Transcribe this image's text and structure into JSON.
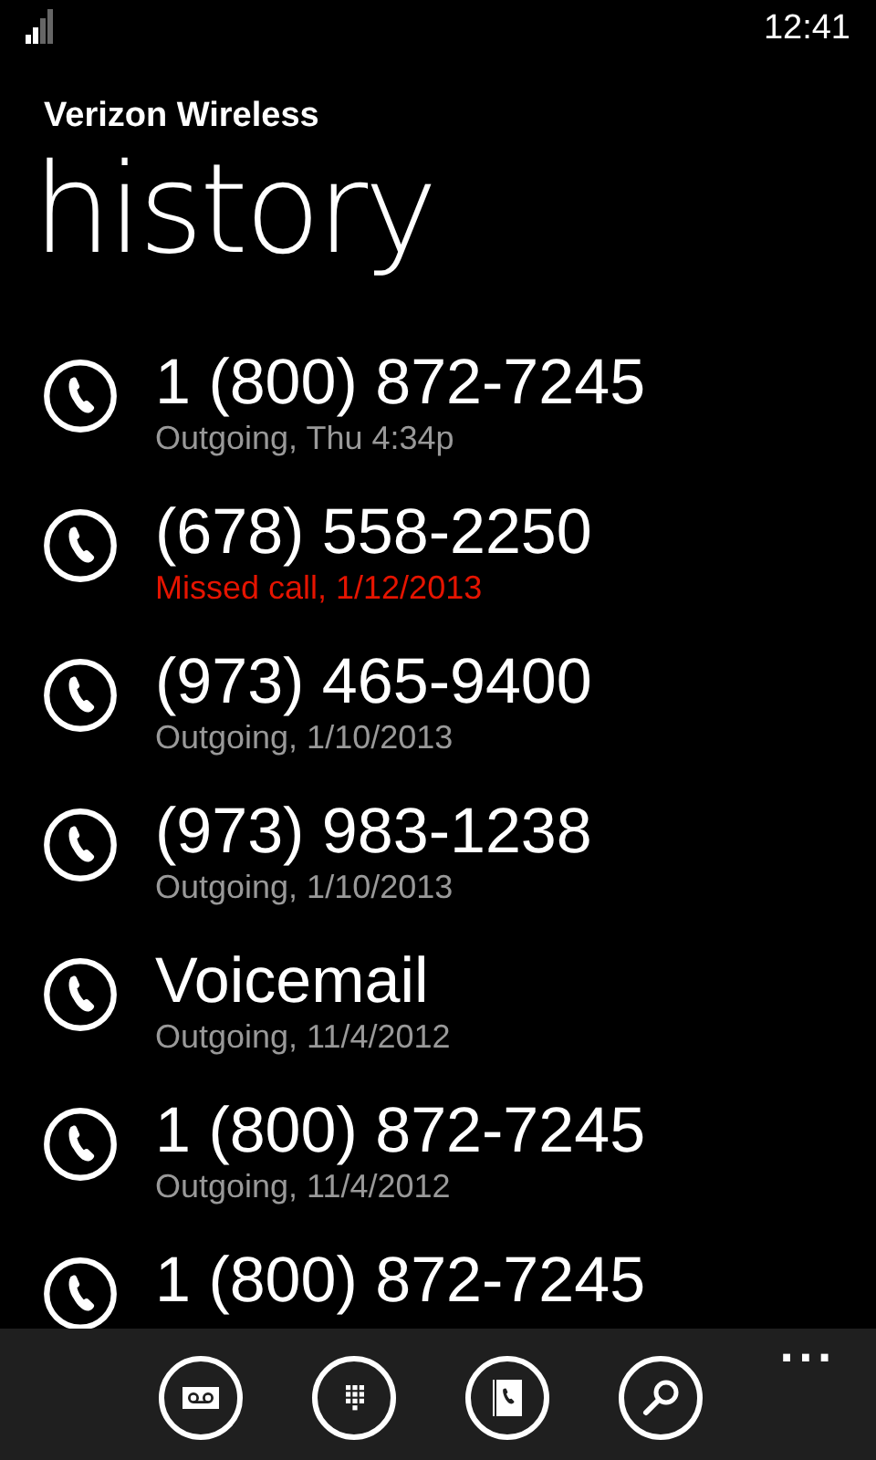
{
  "status_bar": {
    "time": "12:41"
  },
  "header": {
    "account": "Verizon Wireless",
    "title": "history"
  },
  "calls": [
    {
      "number": "1 (800) 872-7245",
      "detail": "Outgoing, Thu 4:34p",
      "missed": false
    },
    {
      "number": "(678) 558-2250",
      "detail": "Missed call, 1/12/2013",
      "missed": true
    },
    {
      "number": "(973) 465-9400",
      "detail": "Outgoing, 1/10/2013",
      "missed": false
    },
    {
      "number": "(973) 983-1238",
      "detail": "Outgoing, 1/10/2013",
      "missed": false
    },
    {
      "number": "Voicemail",
      "detail": "Outgoing, 11/4/2012",
      "missed": false
    },
    {
      "number": "1 (800) 872-7245",
      "detail": "Outgoing, 11/4/2012",
      "missed": false
    },
    {
      "number": "1 (800) 872-7245"
    }
  ],
  "app_bar": {
    "buttons": [
      {
        "kind": "voicemail"
      },
      {
        "kind": "keypad"
      },
      {
        "kind": "contacts"
      },
      {
        "kind": "search"
      }
    ],
    "more": "..."
  }
}
